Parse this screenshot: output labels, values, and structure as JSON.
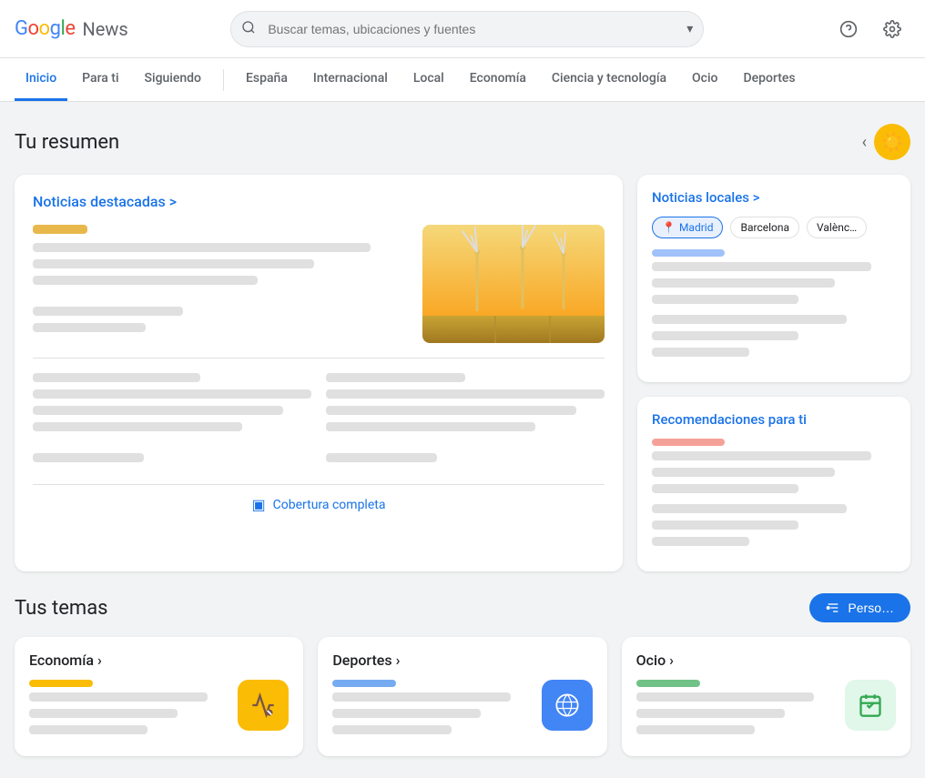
{
  "header": {
    "logo_google": "Google",
    "logo_news": "News",
    "search_placeholder": "Buscar temas, ubicaciones y fuentes"
  },
  "nav": {
    "items": [
      {
        "label": "Inicio",
        "active": true
      },
      {
        "label": "Para ti",
        "active": false
      },
      {
        "label": "Siguiendo",
        "active": false
      },
      {
        "label": "España",
        "active": false
      },
      {
        "label": "Internacional",
        "active": false
      },
      {
        "label": "Local",
        "active": false
      },
      {
        "label": "Economía",
        "active": false
      },
      {
        "label": "Ciencia y tecnología",
        "active": false
      },
      {
        "label": "Ocio",
        "active": false
      },
      {
        "label": "Deportes",
        "active": false
      }
    ]
  },
  "main": {
    "summary_title": "Tu resumen",
    "featured_section": {
      "link_text": "Noticias destacadas >",
      "coverage_text": "Cobertura completa"
    },
    "local_section": {
      "link_text": "Noticias locales >",
      "locations": [
        "Madrid",
        "Barcelona",
        "Valènc…"
      ]
    },
    "recommendations_section": {
      "link_text": "Recomendaciones para ti"
    },
    "tus_temas_title": "Tus temas",
    "personalizar_label": "Perso…",
    "temas": [
      {
        "title": "Economía >",
        "icon": "economia"
      },
      {
        "title": "Deportes >",
        "icon": "deportes"
      },
      {
        "title": "Ocio >",
        "icon": "ocio"
      }
    ]
  }
}
